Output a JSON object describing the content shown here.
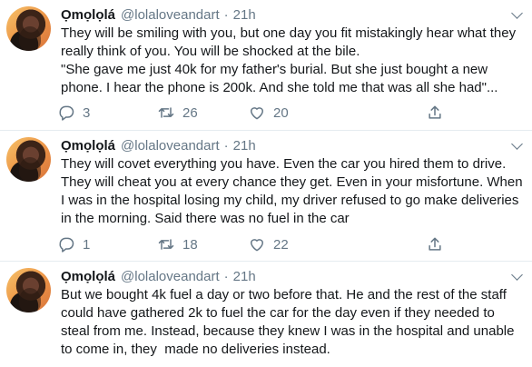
{
  "tweets": [
    {
      "name": "Ọmọlọlá",
      "handle": "@lolaloveandart",
      "separator": "·",
      "time": "21h",
      "text": "They will be smiling with you, but one day you fit mistakingly hear what they\nreally think of you. You will be shocked at the bile.\n\"She gave me just 40k for my father's burial. But she just bought a new\nphone. I hear the phone is 200k. And she told me that was all she had\"...",
      "replies": "3",
      "retweets": "26",
      "likes": "20"
    },
    {
      "name": "Ọmọlọlá",
      "handle": "@lolaloveandart",
      "separator": "·",
      "time": "21h",
      "text": "They will covet everything you have. Even the car you hired them to drive.\nThey will cheat you at every chance they get. Even in your misfortune. When\nI was in the hospital losing my child, my driver refused to go make deliveries\nin the morning. Said there was no fuel in the car",
      "replies": "1",
      "retweets": "18",
      "likes": "22"
    },
    {
      "name": "Ọmọlọlá",
      "handle": "@lolaloveandart",
      "separator": "·",
      "time": "21h",
      "text": "But we bought 4k fuel a day or two before that. He and the rest of the staff\ncould have gathered 2k to fuel the car for the day even if they needed to\nsteal from me. Instead, because they knew I was in the hospital and unable\nto come in, they  made no deliveries instead."
    }
  ],
  "icons": {
    "reply": "reply-icon",
    "retweet": "retweet-icon",
    "like": "heart-icon",
    "share": "share-icon",
    "menu": "chevron-down-icon"
  },
  "colors": {
    "text": "#14171a",
    "secondary": "#657786",
    "divider": "#e6ecf0"
  }
}
